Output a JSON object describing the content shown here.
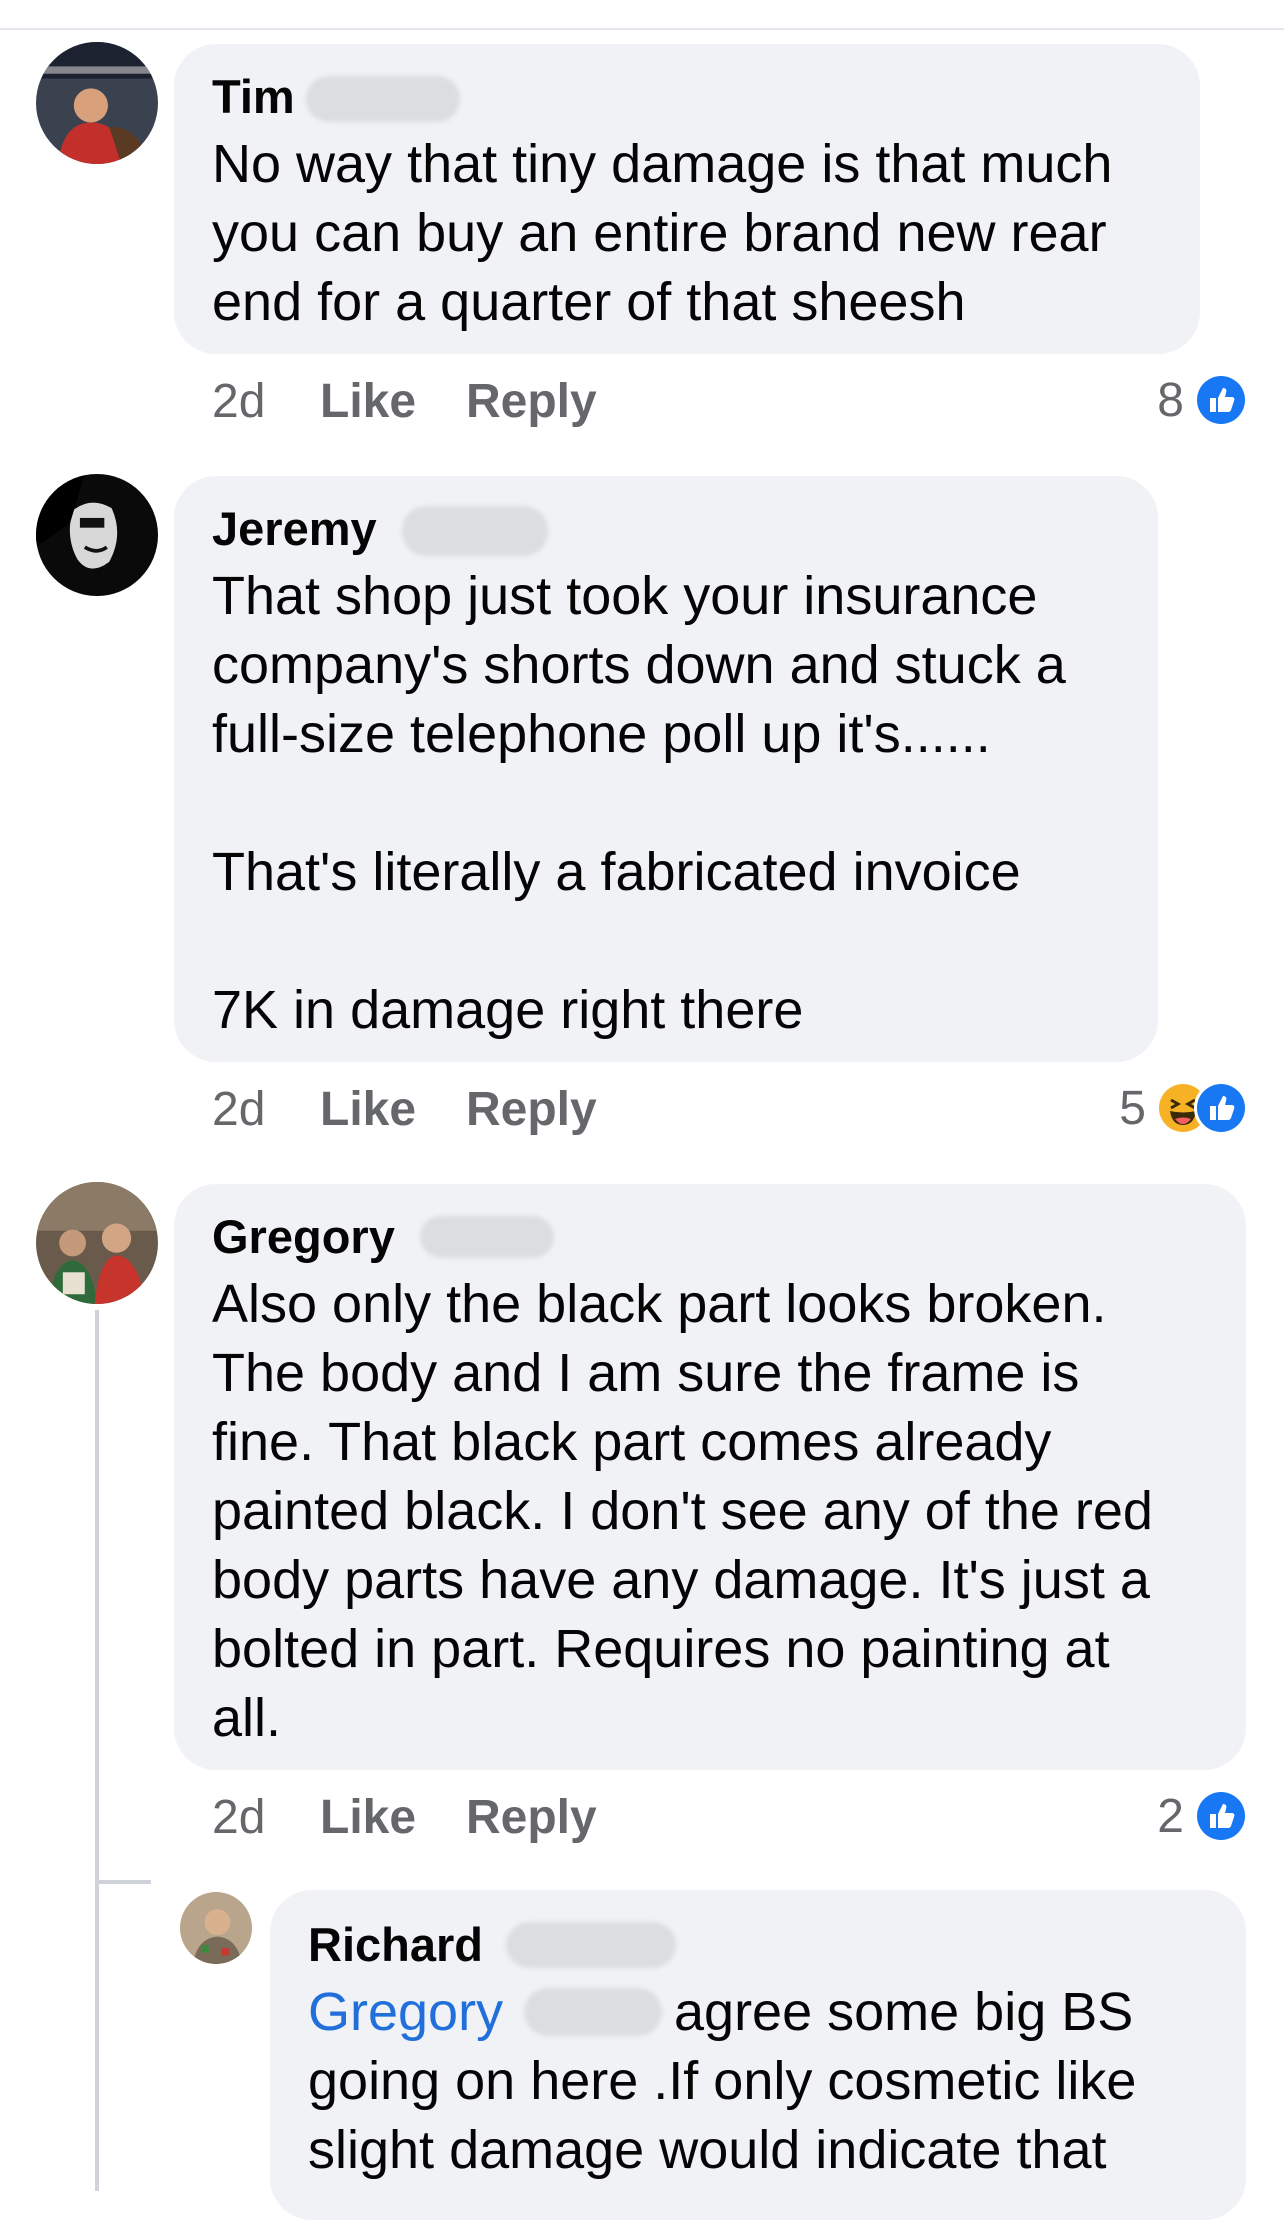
{
  "comments": [
    {
      "name": "Tim",
      "text": "No way that tiny damage is that much\nyou can buy an entire brand new rear\nend for a quarter of that sheesh",
      "time": "2d",
      "like": "Like",
      "reply": "Reply",
      "reaction_count": "8",
      "reactions": [
        "like-icon"
      ]
    },
    {
      "name": "Jeremy",
      "text": "That shop just took your insurance\ncompany's shorts down and stuck a\nfull-size telephone poll up it's......\n\nThat's literally a fabricated invoice\n\n7K in damage right there",
      "time": "2d",
      "like": "Like",
      "reply": "Reply",
      "reaction_count": "5",
      "reactions": [
        "haha-icon",
        "like-icon"
      ]
    },
    {
      "name": "Gregory",
      "text": "Also only the black part looks broken.\nThe body and I am sure the frame is\nfine. That black part comes already\npainted black. I don't see any of the red\nbody parts have any damage. It's just a\nbolted in part. Requires no painting at\nall.",
      "time": "2d",
      "like": "Like",
      "reply": "Reply",
      "reaction_count": "2",
      "reactions": [
        "like-icon"
      ]
    }
  ],
  "reply": {
    "name": "Richard",
    "mention": "Gregory",
    "line1_rest": "agree some  big BS",
    "text_rest": "going on here .If only cosmetic like\nslight damage would indicate that"
  },
  "colors": {
    "bubble": "#f0f2f5",
    "link": "#216fdb",
    "like_blue": "#1877f2",
    "meta": "#65676b"
  }
}
